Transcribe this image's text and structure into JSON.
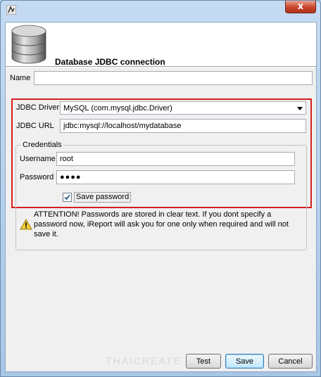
{
  "header": {
    "title": "Database JDBC connection"
  },
  "name": {
    "label": "Name",
    "value": ""
  },
  "driver": {
    "label": "JDBC Driver",
    "value": "MySQL (com.mysql.jdbc.Driver)"
  },
  "url": {
    "label": "JDBC URL",
    "value": "jdbc:mysql://localhost/mydatabase"
  },
  "credentials": {
    "legend": "Credentials",
    "username_label": "Username",
    "username_value": "root",
    "password_label": "Password",
    "password_value": "●●●●",
    "save_password_label": "Save password",
    "save_password_checked": true
  },
  "warning": {
    "text": "ATTENTION! Passwords are stored in clear text. If you dont specify a password now, iReport will ask you for one only when required and will not save it."
  },
  "watermark": "THAICREATE",
  "buttons": {
    "test": "Test",
    "save": "Save",
    "cancel": "Cancel"
  },
  "window": {
    "close_glyph": "x"
  },
  "colors": {
    "highlight_box": "#d81e1e",
    "title_gradient_top": "#c4dbf2",
    "client_bg": "#f0f0f0"
  }
}
